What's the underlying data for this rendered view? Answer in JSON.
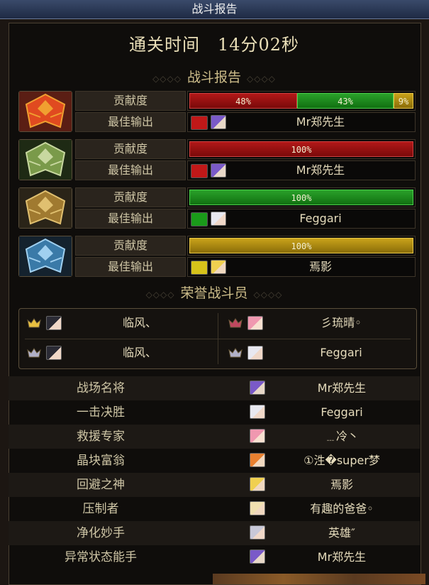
{
  "window": {
    "title": "战斗报告"
  },
  "clear_time": "通关时间　14分02秒",
  "report_heading": "战斗报告",
  "honor_heading": "荣誉战斗员",
  "row_labels": {
    "contribution": "贡献度",
    "top_damage": "最佳输出"
  },
  "bosses": [
    {
      "icon": "fire-helmet-icon",
      "contribution": [
        {
          "value": 48,
          "label": "48%",
          "color": "#b21818"
        },
        {
          "value": 43,
          "label": "43%",
          "color": "#2aa12a"
        },
        {
          "value": 9,
          "label": "9%",
          "color": "#c9a21a"
        }
      ],
      "top_player": {
        "name": "Mr郑先生",
        "class_color": "#c01818",
        "avatar": "purple-hair-avatar"
      }
    },
    {
      "icon": "green-helmet-icon",
      "contribution": [
        {
          "value": 100,
          "label": "100%",
          "color": "#b21818"
        }
      ],
      "top_player": {
        "name": "Mr郑先生",
        "class_color": "#c01818",
        "avatar": "purple-hair-avatar"
      }
    },
    {
      "icon": "gold-helmet-icon",
      "contribution": [
        {
          "value": 100,
          "label": "100%",
          "color": "#2aa12a"
        }
      ],
      "top_player": {
        "name": "Feggari",
        "class_color": "#1a9a1a",
        "avatar": "white-hair-avatar"
      }
    },
    {
      "icon": "blue-helmet-icon",
      "contribution": [
        {
          "value": 100,
          "label": "100%",
          "color": "#c9a21a"
        }
      ],
      "top_player": {
        "name": "焉影",
        "class_color": "#d6c21a",
        "avatar": "blonde-avatar"
      }
    }
  ],
  "honor_members": [
    {
      "name": "临风、",
      "medal": "gold-medal-icon",
      "avatar": "dark-hair-avatar"
    },
    {
      "name": "彡琉晴◦",
      "medal": "red-medal-icon",
      "avatar": "pink-hair-avatar"
    },
    {
      "name": "临风、",
      "medal": "silver-medal-icon",
      "avatar": "dark-hair-avatar"
    },
    {
      "name": "Feggari",
      "medal": "silver-medal-icon",
      "avatar": "white-hair-avatar"
    }
  ],
  "awards": [
    {
      "title": "战场名将",
      "player": "Mr郑先生",
      "avatar": "purple-hair-avatar"
    },
    {
      "title": "一击决胜",
      "player": "Feggari",
      "avatar": "white-hair-avatar"
    },
    {
      "title": "救援专家",
      "player": "﹍冷丶",
      "avatar": "pink-hair-avatar"
    },
    {
      "title": "晶块富翁",
      "player": "①泩�super梦",
      "avatar": "orange-hair-avatar"
    },
    {
      "title": "回避之神",
      "player": "焉影",
      "avatar": "blonde-avatar"
    },
    {
      "title": "压制者",
      "player": "有趣的爸爸◦",
      "avatar": "light-hair-avatar"
    },
    {
      "title": "净化妙手",
      "player": "英雄″",
      "avatar": "silver-hair-avatar"
    },
    {
      "title": "异常状态能手",
      "player": "Mr郑先生",
      "avatar": "purple-hair-avatar"
    }
  ]
}
